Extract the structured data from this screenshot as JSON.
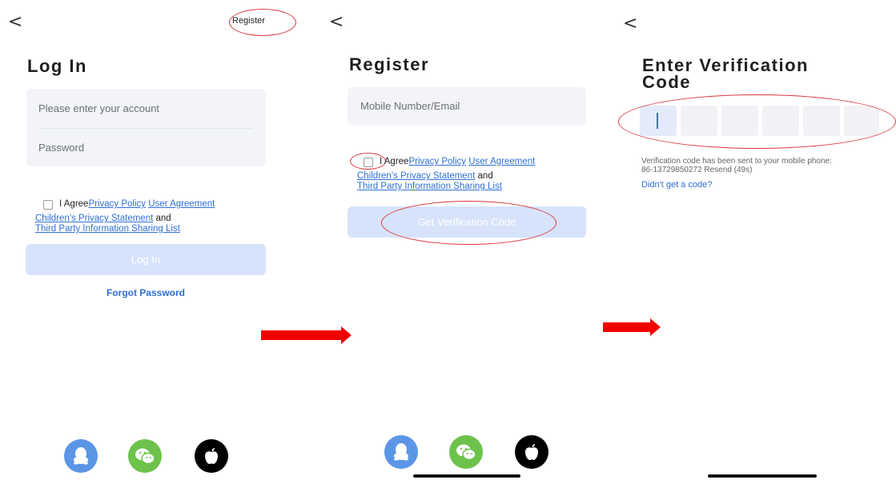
{
  "colors": {
    "accent": "#2f6fd6",
    "button_disabled": "#d7e3fb",
    "annotation": "#d9363e",
    "arrow": "#f20000",
    "qq": "#5b95e6",
    "wechat": "#6cc24a",
    "apple": "#000000"
  },
  "icons": {
    "back": "back-chevron-icon",
    "qq": "qq-penguin-icon",
    "wechat": "wechat-bubbles-icon",
    "apple": "apple-icon"
  },
  "back_glyph": "<",
  "login": {
    "register_link": "Register",
    "title": "Log In",
    "account_placeholder": "Please enter your account",
    "password_placeholder": "Password",
    "agree_text": "I Agree",
    "privacy_policy": "Privacy Policy",
    "user_agreement": "User Agreement",
    "childrens_privacy": "Children's Privacy Statement",
    "and_text": "and",
    "third_party": "Third Party Information Sharing List",
    "login_button": "Log In",
    "forgot_password": "Forgot Password"
  },
  "register": {
    "title": "Register",
    "mobile_placeholder": "Mobile Number/Email",
    "agree_text": "I Agree",
    "privacy_policy": "Privacy Policy",
    "user_agreement": "User Agreement",
    "childrens_privacy": "Children's Privacy Statement",
    "and_text": "and",
    "third_party": "Third Party Information Sharing List",
    "get_code_button": "Get Verification Code"
  },
  "verify": {
    "title_line1": "Enter Verification",
    "title_line2": "Code",
    "code_cells": 6,
    "info_line1": "Verification code has been sent to your mobile phone:",
    "info_line2": "86-13729850272 Resend (49s)",
    "didnt_get": "Didn't get a code?"
  }
}
